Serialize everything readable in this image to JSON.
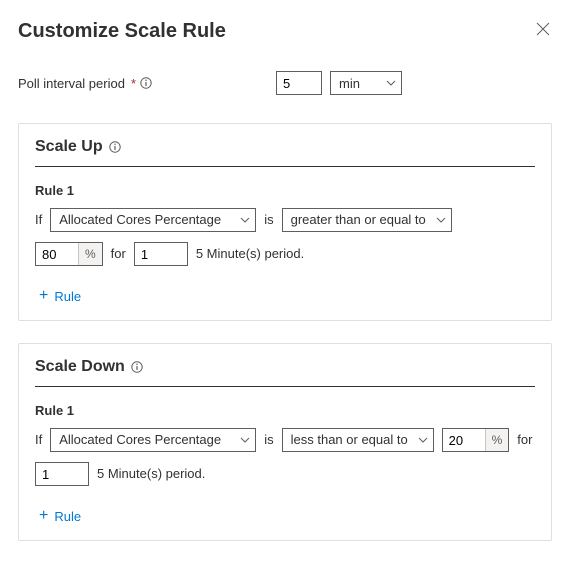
{
  "header": {
    "title": "Customize Scale Rule"
  },
  "poll": {
    "label": "Poll interval period",
    "required": "*",
    "value": "5",
    "unit": "min"
  },
  "scaleUp": {
    "heading": "Scale Up",
    "rule": {
      "title": "Rule 1",
      "ifLabel": "If",
      "metric": "Allocated Cores Percentage",
      "isLabel": "is",
      "operator": "greater than or equal to",
      "threshold": "80",
      "pctSuffix": "%",
      "forLabel": "for",
      "periodCount": "1",
      "periodText": "5 Minute(s) period."
    },
    "addRuleLabel": "Rule"
  },
  "scaleDown": {
    "heading": "Scale Down",
    "rule": {
      "title": "Rule 1",
      "ifLabel": "If",
      "metric": "Allocated Cores Percentage",
      "isLabel": "is",
      "operator": "less than or equal to",
      "threshold": "20",
      "pctSuffix": "%",
      "forLabel": "for",
      "periodCount": "1",
      "periodText": "5 Minute(s) period."
    },
    "addRuleLabel": "Rule"
  }
}
